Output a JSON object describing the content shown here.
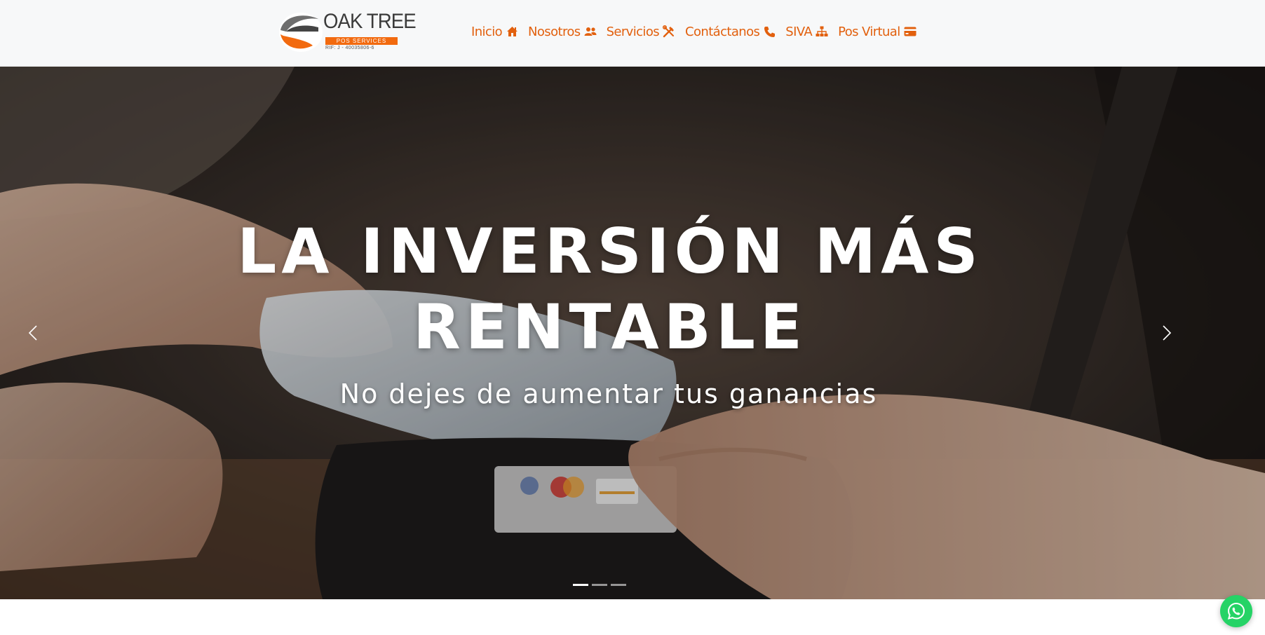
{
  "brand": {
    "name": "OAK TREE",
    "tagline": "POS SERVICES",
    "rif": "RIF: J - 40035806-6"
  },
  "nav": {
    "items": [
      {
        "label": "Inicio",
        "icon": "home-icon"
      },
      {
        "label": "Nosotros",
        "icon": "users-icon"
      },
      {
        "label": "Servicios",
        "icon": "tools-icon"
      },
      {
        "label": "Contáctanos",
        "icon": "phone-icon"
      },
      {
        "label": "SIVA",
        "icon": "sitemap-icon"
      },
      {
        "label": "Pos Virtual",
        "icon": "credit-card-icon"
      }
    ]
  },
  "hero": {
    "title_line1": "LA INVERSIÓN MÁS",
    "title_line2": "RENTABLE",
    "subtitle": "No dejes de aumentar tus ganancias",
    "slides_total": 3,
    "active_slide": 1
  },
  "colors": {
    "accent": "#e2600e",
    "logo_orange": "#f26a0f",
    "header_bg": "#f7f8f9",
    "whatsapp": "#25d366"
  },
  "floating": {
    "icon": "whatsapp-icon"
  }
}
